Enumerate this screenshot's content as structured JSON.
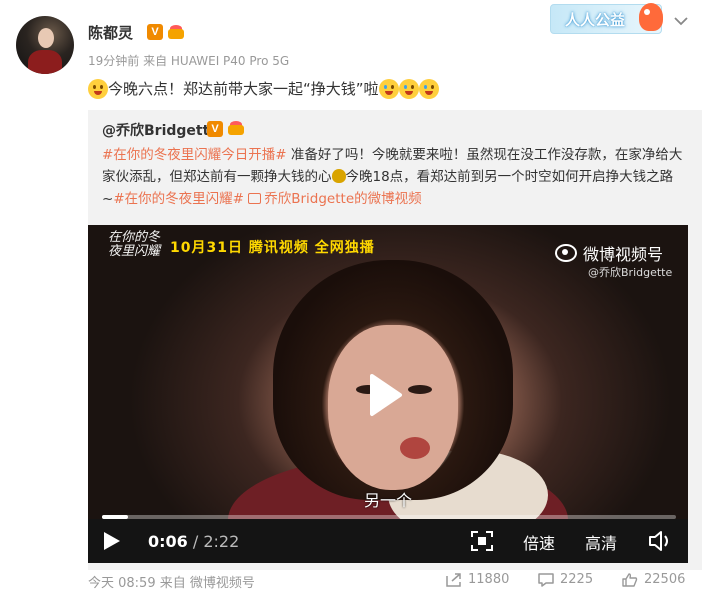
{
  "post": {
    "author": "陈都灵",
    "meta": "19分钟前 来自 HUAWEI P40 Pro 5G",
    "text": "今晚六点！郑达前带大家一起“挣大钱”啦",
    "emojis": [
      "grin-emoji",
      "cry-emoji",
      "cry-emoji",
      "cry-emoji"
    ]
  },
  "promo": {
    "label": "人人公益"
  },
  "repost": {
    "author": "@乔欣Bridgette",
    "tag1": "#在你的冬夜里闪耀今日开播#",
    "text1": " 准备好了吗！今晚就要来啦！虽然现在没工作没存款，在家净给大家伙添乱，但郑达前有一颗挣大钱的心",
    "text2": "今晚18点，看郑达前到另一个时空如何开启挣大钱之路~",
    "tag2": "#在你的冬夜里闪耀#",
    "video_link": "乔欣Bridgette的微博视频"
  },
  "video": {
    "logo_text": "在你的冬夜里闪耀",
    "banner": "10月31日 腾讯视频 全网独播",
    "watermark": "微博视频号",
    "watermark_user": "@乔欣Bridgette",
    "subtitle": "另一个",
    "current_time": "0:06",
    "separator": " / ",
    "duration": "2:22",
    "progress": 0.045,
    "speed_label": "倍速",
    "quality_label": "高清"
  },
  "footer": {
    "meta": "今天 08:59 来自 微博视频号",
    "reposts": "11880",
    "comments": "2225",
    "likes": "22506"
  },
  "colors": {
    "accent": "#eb7350",
    "badge": "#f08a00",
    "banner": "#ffd800"
  }
}
